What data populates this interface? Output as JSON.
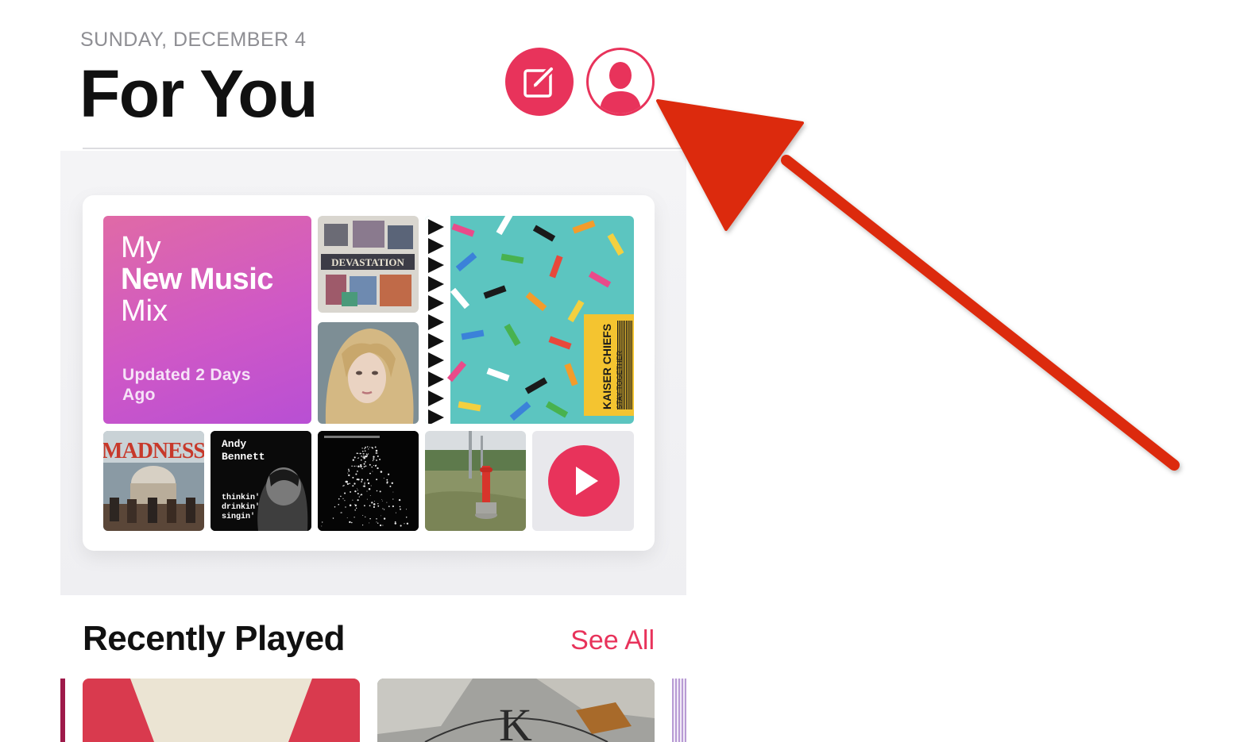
{
  "header": {
    "date": "SUNDAY, DECEMBER 4",
    "title": "For You"
  },
  "mix": {
    "line1": "My",
    "line2": "New Music",
    "line3": "Mix",
    "updated": "Updated 2 Days Ago"
  },
  "albums": {
    "madness": "MADNESS",
    "andy_line1": "Andy",
    "andy_line2": "Bennett",
    "andy_line3": "thinkin'",
    "andy_line4": "drinkin'",
    "andy_line5": "singin'",
    "kaiser": "KAISER CHIEFS",
    "kaiser_sub": "STAY TOGETHER",
    "devastation": "DEVASTATION",
    "recent_k": "K"
  },
  "recently_played": {
    "title": "Recently Played",
    "see_all": "See All"
  },
  "icons": {
    "compose": "compose-icon",
    "profile": "profile-icon",
    "play": "play-icon"
  },
  "colors": {
    "accent": "#e8335b",
    "arrow": "#dc2a0c",
    "mix_gradient_start": "#e06aa6",
    "mix_gradient_end": "#b84fd4"
  }
}
